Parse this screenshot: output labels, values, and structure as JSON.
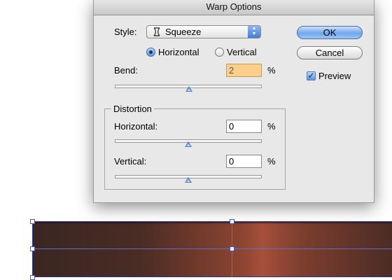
{
  "dialog": {
    "title": "Warp Options",
    "style_label": "Style:",
    "style_value": "Squeeze",
    "orientation": {
      "horizontal_label": "Horizontal",
      "vertical_label": "Vertical",
      "selected": "Horizontal"
    },
    "bend": {
      "label": "Bend:",
      "value": "2",
      "unit": "%",
      "slider_percent": 2
    },
    "distortion": {
      "title": "Distortion",
      "horizontal": {
        "label": "Horizontal:",
        "value": "0",
        "unit": "%",
        "slider_percent": 0
      },
      "vertical": {
        "label": "Vertical:",
        "value": "0",
        "unit": "%",
        "slider_percent": 0
      }
    },
    "buttons": {
      "ok": "OK",
      "cancel": "Cancel"
    },
    "preview": {
      "label": "Preview",
      "checked": true
    }
  },
  "colors": {
    "accent": "#5c95e4",
    "field_focus": "#fcd08a",
    "artwork_dark": "#3a2622",
    "artwork_light": "#a5503a"
  }
}
